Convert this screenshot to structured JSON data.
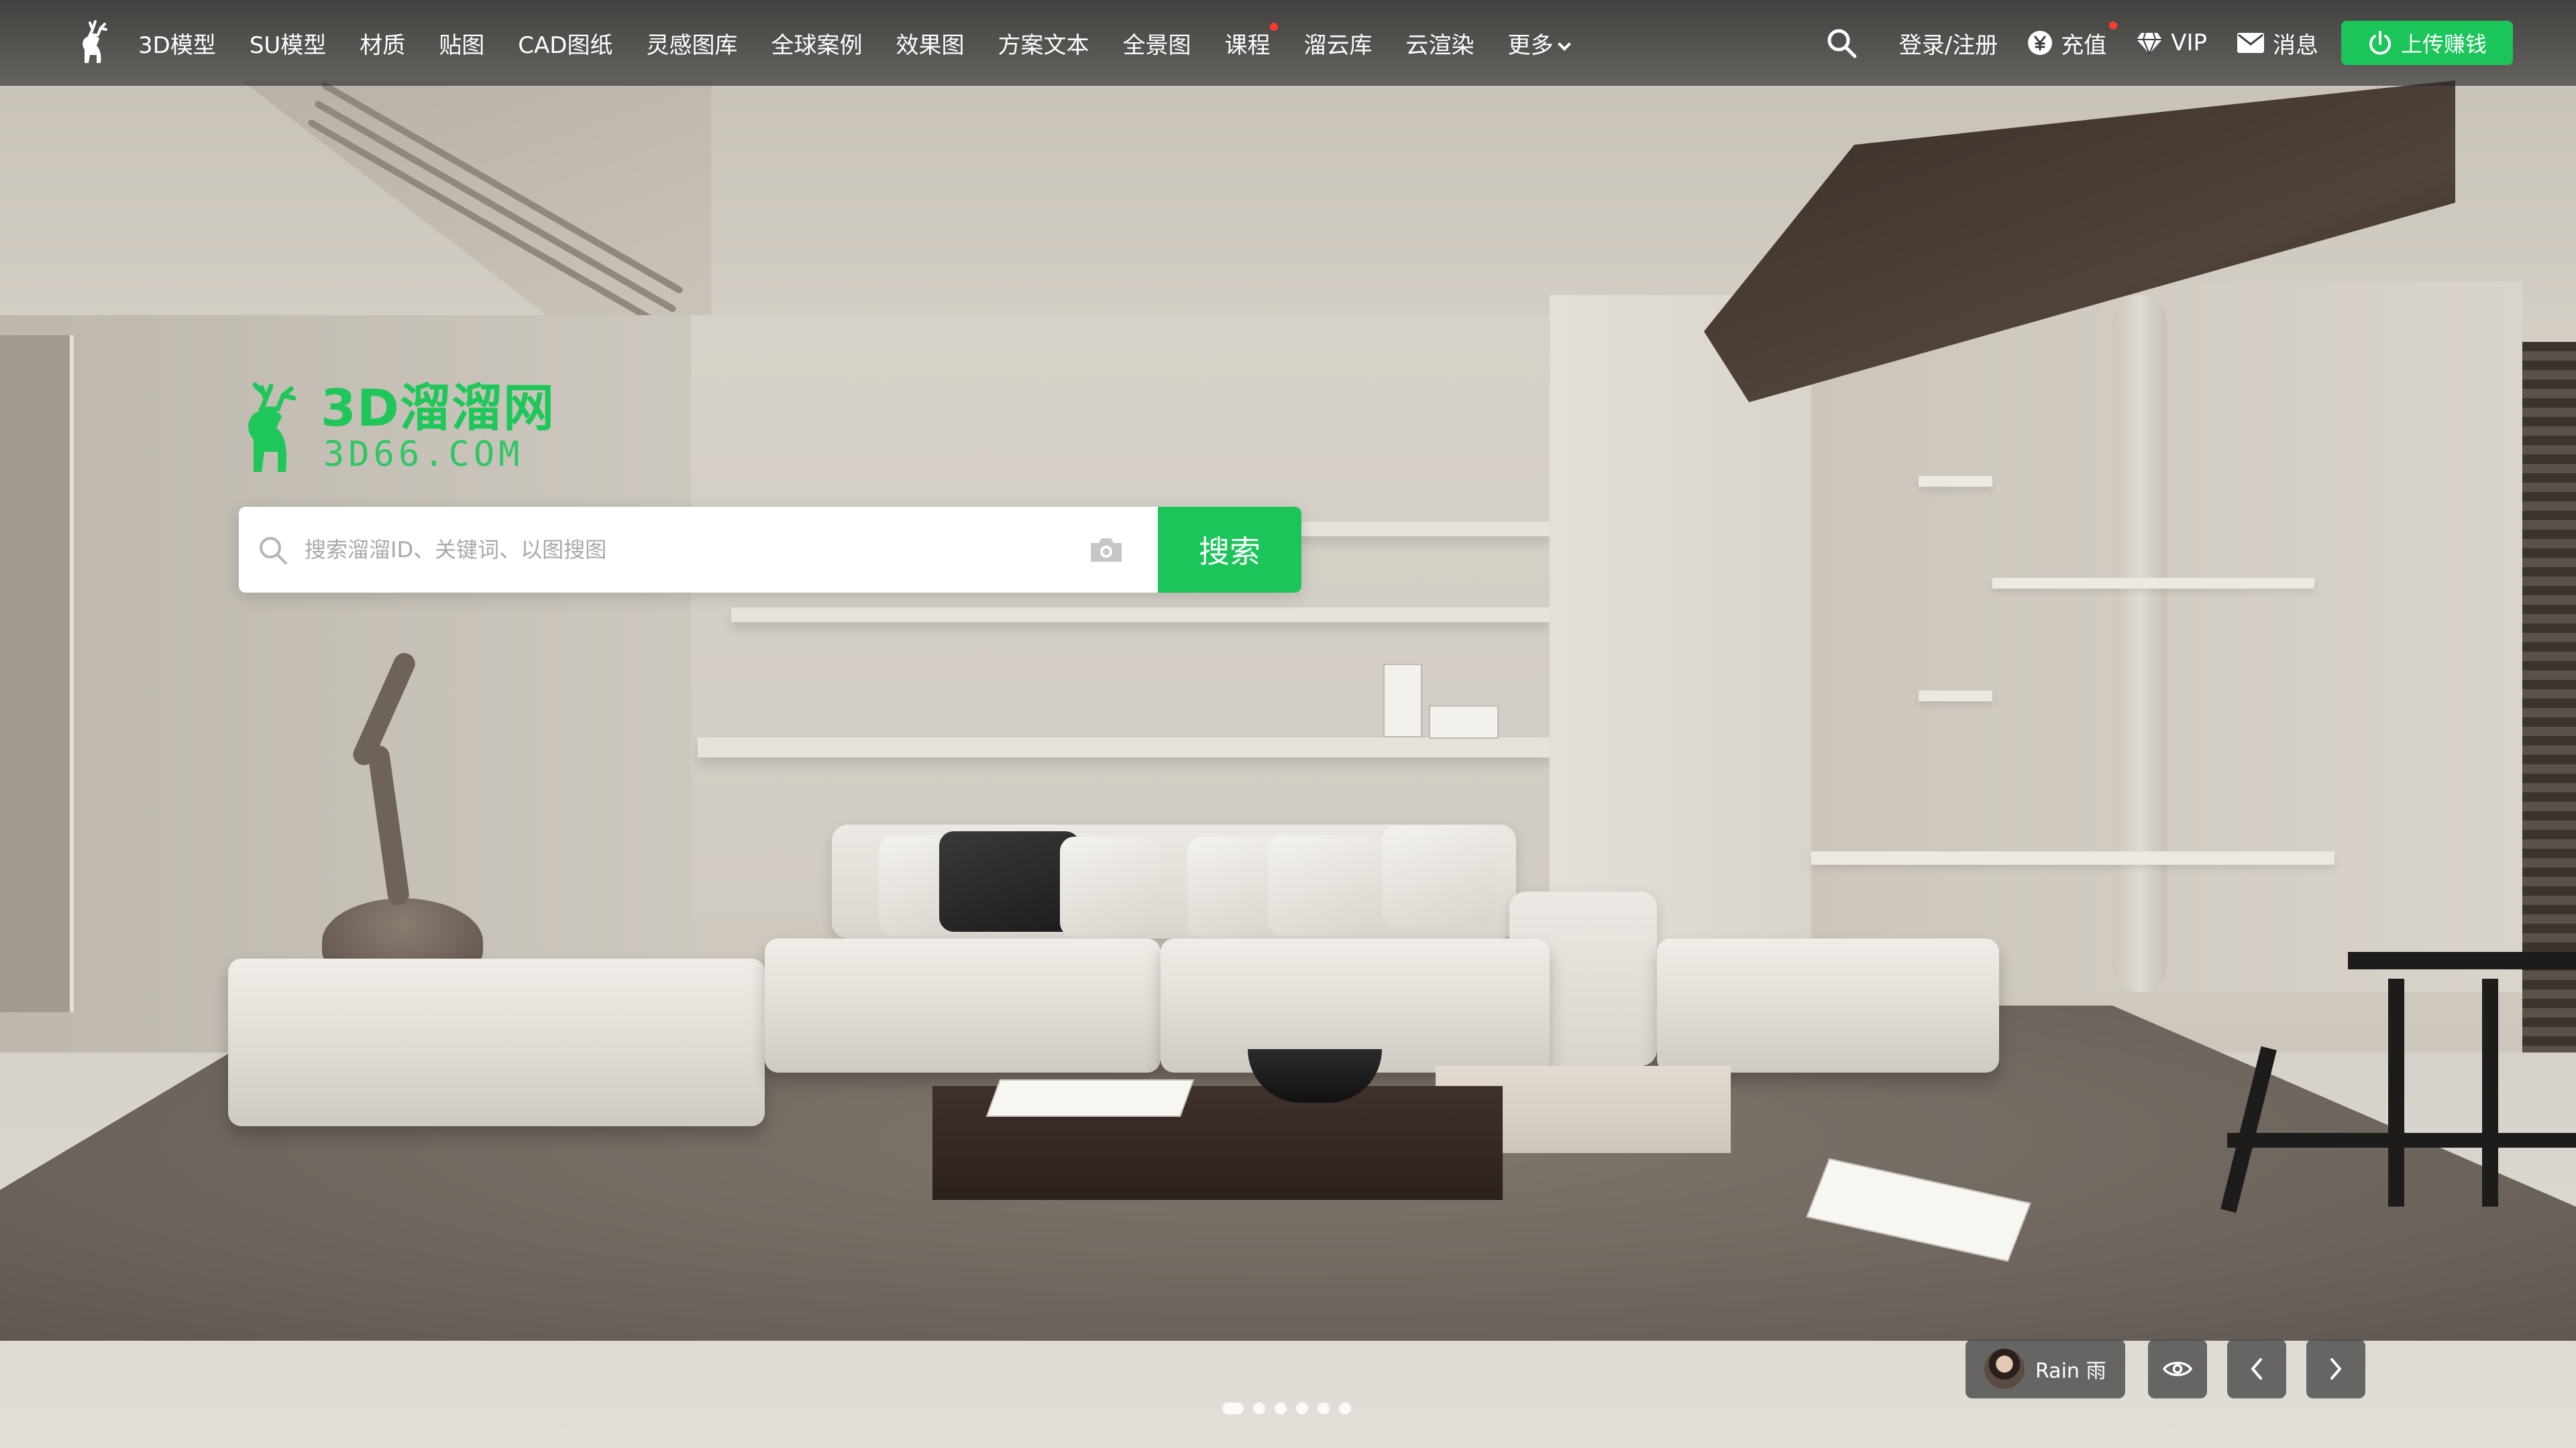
{
  "nav": {
    "items": [
      {
        "label": "3D模型",
        "badge": false
      },
      {
        "label": "SU模型",
        "badge": false
      },
      {
        "label": "材质",
        "badge": false
      },
      {
        "label": "贴图",
        "badge": false
      },
      {
        "label": "CAD图纸",
        "badge": false
      },
      {
        "label": "灵感图库",
        "badge": false
      },
      {
        "label": "全球案例",
        "badge": false
      },
      {
        "label": "效果图",
        "badge": false
      },
      {
        "label": "方案文本",
        "badge": false
      },
      {
        "label": "全景图",
        "badge": false
      },
      {
        "label": "课程",
        "badge": true
      },
      {
        "label": "溜云库",
        "badge": false
      },
      {
        "label": "云渲染",
        "badge": false
      }
    ],
    "more_label": "更多",
    "login_label": "登录/注册",
    "recharge_label": "充值",
    "vip_label": "VIP",
    "messages_label": "消息",
    "upload_label": "上传赚钱"
  },
  "hero": {
    "brand_cn": "3D溜溜网",
    "brand_en": "3D66.COM",
    "search_placeholder": "搜索溜溜ID、关键词、以图搜图",
    "search_button": "搜索"
  },
  "carousel": {
    "author": "Rain 雨",
    "slide_count": 6,
    "active_index": 0
  },
  "colors": {
    "brand_green": "#1bc55a",
    "badge_red": "#ff3b30",
    "nav_bg": "#2b2b2b"
  },
  "icons": {
    "logo": "deer-logo-icon",
    "search": "search-icon",
    "recharge": "yen-coin-icon",
    "vip": "diamond-icon",
    "messages": "envelope-icon",
    "upload": "power-upload-icon",
    "camera": "camera-icon",
    "preview": "eye-icon",
    "prev": "chevron-left-icon",
    "next": "chevron-right-icon"
  }
}
